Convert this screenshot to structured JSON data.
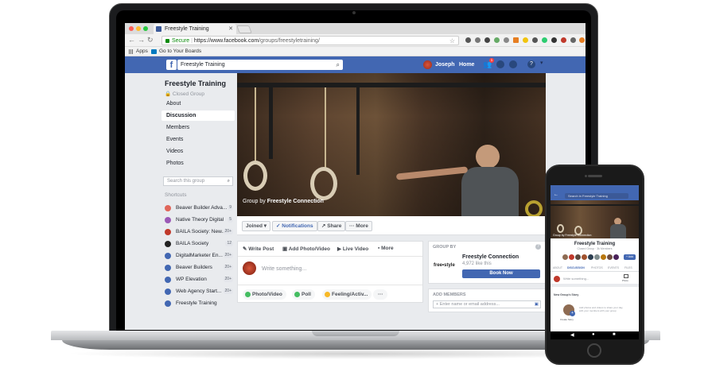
{
  "browser": {
    "tab_title": "Freestyle Training",
    "url_secure": "Secure",
    "url_host": "https://www.facebook.com",
    "url_path": "/groups/freestyletraining/",
    "bookmarks": [
      "Apps",
      "Go to Your Boards"
    ]
  },
  "fb_header": {
    "search_value": "Freestyle Training",
    "user_name": "Joseph",
    "home_label": "Home",
    "friend_badge": "1"
  },
  "group": {
    "name": "Freestyle Training",
    "privacy": "Closed Group",
    "nav": [
      "About",
      "Discussion",
      "Members",
      "Events",
      "Videos",
      "Photos"
    ],
    "active_nav": "Discussion",
    "search_placeholder": "Search this group",
    "cover_caption_prefix": "Group by",
    "cover_caption_owner": "Freestyle Connection"
  },
  "shortcuts": {
    "heading": "Shortcuts",
    "items": [
      {
        "label": "Beaver Builder Adva...",
        "count": "9",
        "color": "#e0665a"
      },
      {
        "label": "Native Theory Digital",
        "count": "5",
        "color": "#9b59b6"
      },
      {
        "label": "BAILA Society: New...",
        "count": "20+",
        "color": "#c0392b"
      },
      {
        "label": "BAILA Society",
        "count": "12",
        "color": "#222222"
      },
      {
        "label": "DigitalMarketer En...",
        "count": "20+",
        "color": "#4267b2"
      },
      {
        "label": "Beaver Builders",
        "count": "20+",
        "color": "#4267b2"
      },
      {
        "label": "WP Elevation",
        "count": "20+",
        "color": "#4267b2"
      },
      {
        "label": "Web Agency Start...",
        "count": "20+",
        "color": "#4267b2"
      },
      {
        "label": "Freestyle Training",
        "count": "",
        "color": "#4267b2"
      }
    ]
  },
  "actions": {
    "joined": "Joined ▾",
    "notifications": "✓ Notifications",
    "share": "↗ Share",
    "more": "··· More"
  },
  "composer": {
    "tabs": [
      "Write Post",
      "Add Photo/Video",
      "Live Video",
      "More"
    ],
    "placeholder": "Write something...",
    "buttons": [
      "Photo/Video",
      "Poll",
      "Feeling/Activ...",
      "···"
    ]
  },
  "group_by": {
    "heading": "GROUP BY",
    "owner": "Freestyle Connection",
    "logo_text": "free•style",
    "likes": "4,972 like this",
    "book_label": "Book Now"
  },
  "add_members": {
    "heading": "ADD MEMBERS",
    "placeholder": "+ Enter name or email address..."
  },
  "phone": {
    "search": "Search in Freestyle Training",
    "group_name": "Freestyle Training",
    "group_sub": "Closed Group · 3k Members",
    "cover_caption": "Group by Freestyle Connection",
    "add_label": "+ Add",
    "tabs": [
      "ABOUT",
      "DISCUSSION",
      "PHOTOS",
      "EVENTS",
      "FILES"
    ],
    "write": "Write something...",
    "photo_label": "Photo",
    "story_heading": "New Group's Story",
    "story_text": "Add photos and videos to share your day, with your members with your group",
    "create_story": "Create Story"
  }
}
